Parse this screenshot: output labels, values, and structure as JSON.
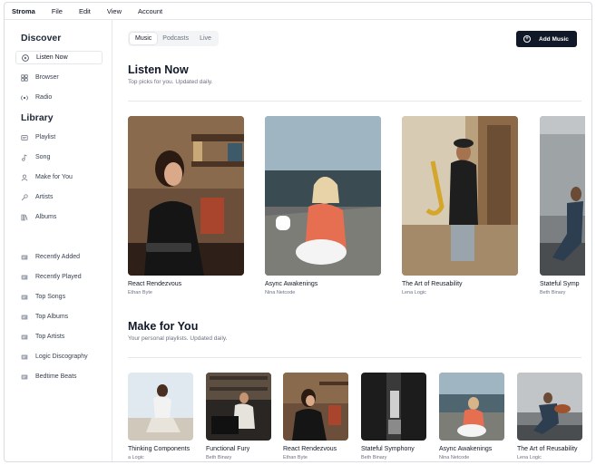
{
  "menubar": {
    "items": [
      "Stroma",
      "File",
      "Edit",
      "View",
      "Account"
    ]
  },
  "sidebar": {
    "discover_title": "Discover",
    "discover_items": [
      {
        "label": "Listen Now",
        "icon": "play-circle-icon"
      },
      {
        "label": "Browser",
        "icon": "grid-icon"
      },
      {
        "label": "Radio",
        "icon": "radio-icon"
      }
    ],
    "library_title": "Library",
    "library_items": [
      {
        "label": "Playlist",
        "icon": "playlist-icon"
      },
      {
        "label": "Song",
        "icon": "music-note-icon"
      },
      {
        "label": "Make for You",
        "icon": "user-icon"
      },
      {
        "label": "Artists",
        "icon": "microphone-icon"
      },
      {
        "label": "Albums",
        "icon": "library-icon"
      }
    ],
    "playlists": [
      "Recently Added",
      "Recently Played",
      "Top Songs",
      "Top Albums",
      "Top Artists",
      "Logic Discography",
      "Bedtime Beats"
    ]
  },
  "main": {
    "tabs": [
      {
        "label": "Music",
        "active": true
      },
      {
        "label": "Podcasts",
        "active": false
      },
      {
        "label": "Live",
        "active": false
      }
    ],
    "add_music_label": "Add Music",
    "listen_now": {
      "title": "Listen Now",
      "subtitle": "Top picks for you. Updated daily.",
      "albums": [
        {
          "title": "React Rendezvous",
          "artist": "Ethan Byte"
        },
        {
          "title": "Async Awakenings",
          "artist": "Nina Netcode"
        },
        {
          "title": "The Art of Reusability",
          "artist": "Lena Logic"
        },
        {
          "title": "Stateful Symp",
          "artist": "Beth Binary"
        }
      ]
    },
    "made_for_you": {
      "title": "Make for You",
      "subtitle": "Your personal playlists. Updated daily.",
      "albums": [
        {
          "title": "Thinking Components",
          "artist": "a Logic"
        },
        {
          "title": "Functional Fury",
          "artist": "Beth Binary"
        },
        {
          "title": "React Rendezvous",
          "artist": "Ethan Byte"
        },
        {
          "title": "Stateful Symphony",
          "artist": "Beth Binary"
        },
        {
          "title": "Async Awakenings",
          "artist": "Nina Netcode"
        },
        {
          "title": "The Art of Reusability",
          "artist": "Lena Logic"
        }
      ]
    }
  },
  "colors": {
    "accent_dark": "#111827",
    "muted_text": "#6b7280",
    "border": "#e5e7eb"
  }
}
